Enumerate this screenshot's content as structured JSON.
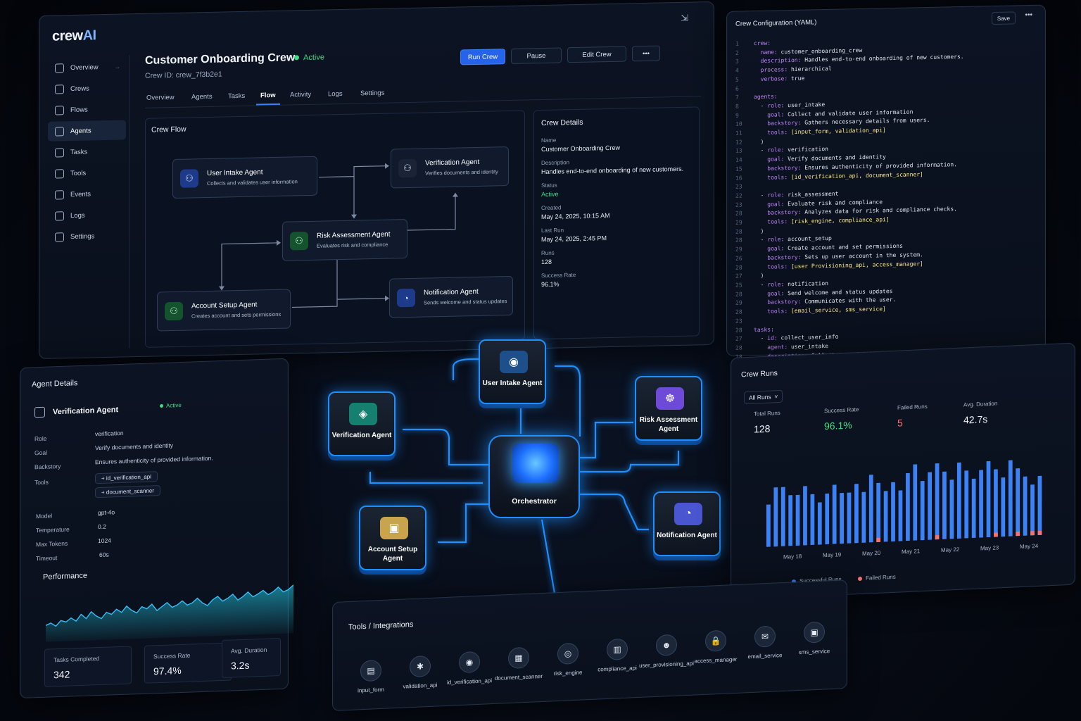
{
  "app": {
    "logo_main": "crew",
    "logo_accent": "AI",
    "pin_icon": "pin-icon"
  },
  "sidebar": {
    "items": [
      {
        "label": "Overview",
        "icon": "home-icon"
      },
      {
        "label": "Crews",
        "icon": "crew-icon"
      },
      {
        "label": "Flows",
        "icon": "flow-icon"
      },
      {
        "label": "Agents",
        "icon": "agent-icon"
      },
      {
        "label": "Tasks",
        "icon": "task-icon"
      },
      {
        "label": "Tools",
        "icon": "tool-icon"
      },
      {
        "label": "Events",
        "icon": "event-icon"
      },
      {
        "label": "Logs",
        "icon": "log-icon"
      },
      {
        "label": "Settings",
        "icon": "gear-icon"
      }
    ]
  },
  "crew": {
    "title": "Customer Onboarding Crew",
    "status": "Active",
    "id": "Crew ID: crew_7f3b2e1"
  },
  "toolbar": {
    "run": "Run Crew",
    "pause": "Pause",
    "edit": "Edit Crew",
    "more": "•••"
  },
  "tabs": [
    "Overview",
    "Agents",
    "Tasks",
    "Flow",
    "Activity",
    "Logs",
    "Settings"
  ],
  "flow": {
    "title": "Crew Flow",
    "nodes": [
      {
        "title": "User Intake Agent",
        "sub": "Collects and validates user information"
      },
      {
        "title": "Verification Agent",
        "sub": "Verifies documents and identity"
      },
      {
        "title": "Risk Assessment Agent",
        "sub": "Evaluates risk and compliance"
      },
      {
        "title": "Account Setup Agent",
        "sub": "Creates account and sets permissions"
      },
      {
        "title": "Notification Agent",
        "sub": "Sends welcome and status updates"
      }
    ]
  },
  "details": {
    "title": "Crew Details",
    "name_label": "Name",
    "name": "Customer Onboarding Crew",
    "desc_label": "Description",
    "desc": "Handles end-to-end onboarding of new customers.",
    "status_label": "Status",
    "status": "Active",
    "created_label": "Created",
    "created": "May 24, 2025, 10:15 AM",
    "lastrun_label": "Last Run",
    "lastrun": "May 24, 2025, 2:45 PM",
    "runs_label": "Runs",
    "runs": "128",
    "rate_label": "Success Rate",
    "rate": "96.1%"
  },
  "yaml": {
    "title": "Crew Configuration (YAML)",
    "save": "Save",
    "more": "•••",
    "lines": [
      {
        "n": "1",
        "t": "crew:"
      },
      {
        "n": "2",
        "t": "  name: customer_onboarding_crew"
      },
      {
        "n": "3",
        "t": "  description: Handles end-to-end onboarding of new customers."
      },
      {
        "n": "4",
        "t": "  process: hierarchical"
      },
      {
        "n": "5",
        "t": "  verbose: true"
      },
      {
        "n": "6",
        "t": ""
      },
      {
        "n": "7",
        "t": "agents:"
      },
      {
        "n": "8",
        "t": "  - role: user_intake"
      },
      {
        "n": "9",
        "t": "    goal: Collect and validate user information"
      },
      {
        "n": "10",
        "t": "    backstory: Gathers necessary details from users."
      },
      {
        "n": "11",
        "t": "    tools: [input_form, validation_api]"
      },
      {
        "n": "12",
        "t": "  )"
      },
      {
        "n": "13",
        "t": "  - role: verification"
      },
      {
        "n": "14",
        "t": "    goal: Verify documents and identity"
      },
      {
        "n": "15",
        "t": "    backstory: Ensures authenticity of provided information."
      },
      {
        "n": "16",
        "t": "    tools: [id_verification_api, document_scanner]"
      },
      {
        "n": "23",
        "t": ""
      },
      {
        "n": "22",
        "t": "  - role: risk_assessment"
      },
      {
        "n": "23",
        "t": "    goal: Evaluate risk and compliance"
      },
      {
        "n": "28",
        "t": "    backstory: Analyzes data for risk and compliance checks."
      },
      {
        "n": "29",
        "t": "    tools: [risk_engine, compliance_api]"
      },
      {
        "n": "28",
        "t": "  )"
      },
      {
        "n": "28",
        "t": "  - role: account_setup"
      },
      {
        "n": "29",
        "t": "    goal: Create account and set permissions"
      },
      {
        "n": "26",
        "t": "    backstory: Sets up user account in the system."
      },
      {
        "n": "28",
        "t": "    tools: [user Provisioning_api, access_manager]"
      },
      {
        "n": "27",
        "t": "  )"
      },
      {
        "n": "25",
        "t": "  - role: notification"
      },
      {
        "n": "28",
        "t": "    goal: Send welcome and status updates"
      },
      {
        "n": "29",
        "t": "    backstory: Communicates with the user."
      },
      {
        "n": "28",
        "t": "    tools: [email_service, sms_service]"
      },
      {
        "n": "23",
        "t": ""
      },
      {
        "n": "28",
        "t": "tasks:"
      },
      {
        "n": "27",
        "t": "  - id: collect_user_info"
      },
      {
        "n": "28",
        "t": "    agent: user_intake"
      },
      {
        "n": "28",
        "t": "    description: Collect user details and validate inputs"
      }
    ]
  },
  "agent": {
    "title": "Agent Details",
    "name": "Verification Agent",
    "status": "Active",
    "role_label": "Role",
    "role": "verification",
    "goal_label": "Goal",
    "goal": "Verify documents and identity",
    "backstory_label": "Backstory",
    "backstory": "Ensures authenticity of provided information.",
    "tools_label": "Tools",
    "tools": [
      "id_verification_api",
      "document_scanner"
    ],
    "model_label": "Model",
    "model": "gpt-4o",
    "temp_label": "Temperature",
    "temp": "0.2",
    "tokens_label": "Max Tokens",
    "tokens": "1024",
    "timeout_label": "Timeout",
    "timeout": "60s",
    "perf_title": "Performance",
    "stats": [
      {
        "label": "Tasks Completed",
        "value": "342"
      },
      {
        "label": "Success Rate",
        "value": "97.4%"
      },
      {
        "label": "Avg. Duration",
        "value": "3.2s"
      }
    ]
  },
  "graph": {
    "center": "Orchestrator",
    "blocks": [
      {
        "label": "User Intake Agent",
        "color": "#1d4f8a",
        "icon": "chat-icon"
      },
      {
        "label": "Verification Agent",
        "color": "#15806f",
        "icon": "shield-icon"
      },
      {
        "label": "Risk Assessment Agent",
        "color": "#6d4bd6",
        "icon": "radar-icon"
      },
      {
        "label": "Account Setup Agent",
        "color": "#c8a54a",
        "icon": "id-card-icon"
      },
      {
        "label": "Notification Agent",
        "color": "#4a55d0",
        "icon": "bell-icon"
      }
    ]
  },
  "runs": {
    "title": "Crew Runs",
    "filter": "All Runs",
    "stats": [
      {
        "label": "Total Runs",
        "value": "128",
        "color": "#f3f6fb"
      },
      {
        "label": "Success Rate",
        "value": "96.1%",
        "color": "#3ddc84"
      },
      {
        "label": "Failed Runs",
        "value": "5",
        "color": "#f87171"
      },
      {
        "label": "Avg. Duration",
        "value": "42.7s",
        "color": "#f3f6fb"
      }
    ],
    "legend_success": "Successful Runs",
    "legend_failed": "Failed Runs"
  },
  "chart_data": {
    "type": "bar",
    "x_tick_labels": [
      "May 18",
      "May 19",
      "May 20",
      "May 21",
      "May 22",
      "May 23",
      "May 24"
    ],
    "series": [
      {
        "name": "Successful Runs",
        "color": "#3b82f6",
        "values": [
          5,
          7,
          7,
          6,
          6,
          7,
          6,
          5,
          6,
          7,
          6,
          6,
          7,
          6,
          8,
          7,
          6,
          7,
          6,
          8,
          9,
          7,
          8,
          9,
          8,
          7,
          9,
          8,
          7,
          8,
          9,
          8,
          7,
          9,
          8,
          7,
          6,
          7
        ]
      },
      {
        "name": "Failed Runs",
        "color": "#f87171",
        "values": [
          0,
          0,
          0,
          0,
          0,
          0,
          0,
          0,
          0,
          0,
          0,
          0,
          0,
          0,
          0,
          0.5,
          0,
          0,
          0,
          0,
          0,
          0,
          0,
          0.5,
          0,
          0,
          0,
          0,
          0,
          0,
          0,
          0.5,
          0,
          0,
          0.5,
          0,
          0.5,
          0.5
        ]
      }
    ],
    "ylim": [
      0,
      10
    ]
  },
  "performance_series": [
    30,
    34,
    28,
    38,
    35,
    42,
    36,
    48,
    40,
    52,
    44,
    39,
    50,
    46,
    55,
    49,
    60,
    52,
    47,
    58,
    54,
    62,
    50,
    57,
    64,
    55,
    59,
    66,
    58,
    62,
    70,
    61,
    56,
    66,
    72,
    63,
    68,
    75,
    64,
    70,
    78,
    69,
    74,
    80,
    72,
    77,
    85,
    76,
    80,
    88
  ],
  "tools": {
    "title": "Tools / Integrations",
    "items": [
      {
        "label": "input_form",
        "glyph": "▤",
        "icon": "form-icon"
      },
      {
        "label": "validation_api",
        "glyph": "✱",
        "icon": "validation-icon"
      },
      {
        "label": "id_verification_api",
        "glyph": "◉",
        "icon": "id-verify-icon"
      },
      {
        "label": "document_scanner",
        "glyph": "▦",
        "icon": "scanner-icon"
      },
      {
        "label": "risk_engine",
        "glyph": "◎",
        "icon": "risk-icon"
      },
      {
        "label": "compliance_api",
        "glyph": "▥",
        "icon": "compliance-icon"
      },
      {
        "label": "user_provisioning_api",
        "glyph": "☻",
        "icon": "user-icon"
      },
      {
        "label": "access_manager",
        "glyph": "🔒",
        "icon": "lock-icon"
      },
      {
        "label": "email_service",
        "glyph": "✉",
        "icon": "mail-icon"
      },
      {
        "label": "sms_service",
        "glyph": "▣",
        "icon": "sms-icon"
      }
    ]
  }
}
